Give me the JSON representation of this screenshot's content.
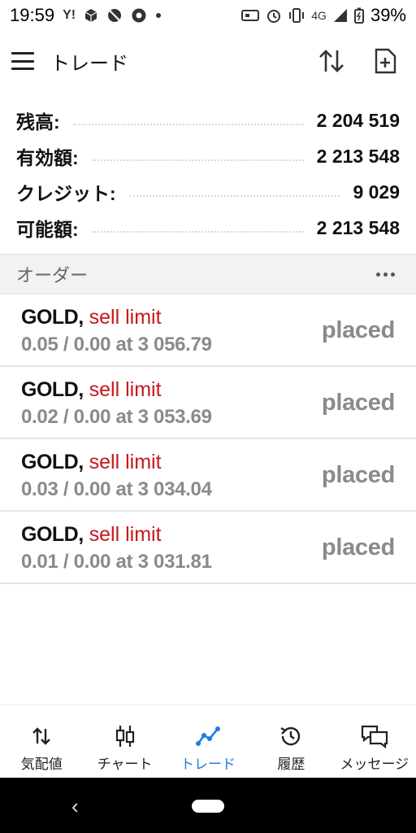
{
  "status_bar": {
    "time": "19:59",
    "yahoo": "Y!",
    "network": "4G",
    "battery": "39%"
  },
  "app_bar": {
    "title": "トレード"
  },
  "balances": [
    {
      "label": "残高:",
      "value": "2 204 519"
    },
    {
      "label": "有効額:",
      "value": "2 213 548"
    },
    {
      "label": "クレジット:",
      "value": "9 029"
    },
    {
      "label": "可能額:",
      "value": "2 213 548"
    }
  ],
  "orders_section": {
    "title": "オーダー"
  },
  "orders": [
    {
      "symbol": "GOLD,",
      "type": "sell limit",
      "detail": "0.05 / 0.00 at 3 056.79",
      "status": "placed"
    },
    {
      "symbol": "GOLD,",
      "type": "sell limit",
      "detail": "0.02 / 0.00 at 3 053.69",
      "status": "placed"
    },
    {
      "symbol": "GOLD,",
      "type": "sell limit",
      "detail": "0.03 / 0.00 at 3 034.04",
      "status": "placed"
    },
    {
      "symbol": "GOLD,",
      "type": "sell limit",
      "detail": "0.01 / 0.00 at 3 031.81",
      "status": "placed"
    }
  ],
  "bottom_nav": [
    {
      "label": "気配値",
      "icon": "quotes-arrows-icon",
      "active": false
    },
    {
      "label": "チャート",
      "icon": "candlestick-icon",
      "active": false
    },
    {
      "label": "トレード",
      "icon": "trade-line-icon",
      "active": true
    },
    {
      "label": "履歴",
      "icon": "history-icon",
      "active": false
    },
    {
      "label": "メッセージ",
      "icon": "messages-icon",
      "active": false
    }
  ],
  "colors": {
    "accent": "#1e7be6",
    "sell": "#c81818",
    "muted": "#8a8a8a",
    "header_bg": "#f2f2f2"
  }
}
